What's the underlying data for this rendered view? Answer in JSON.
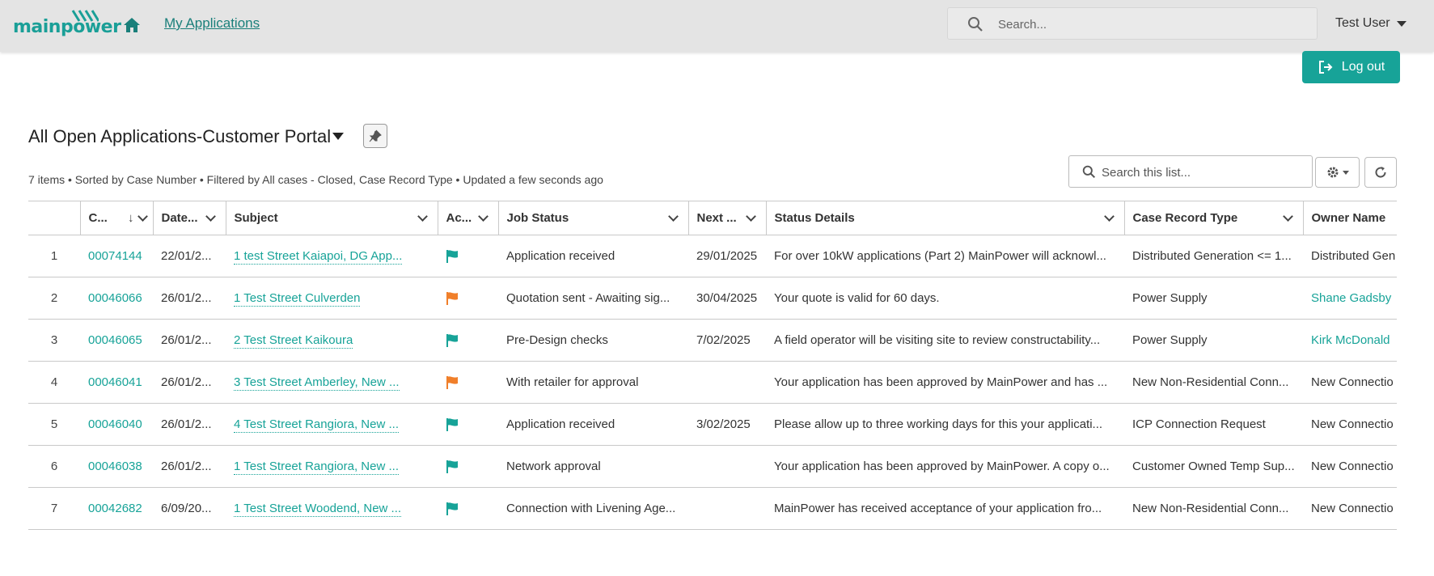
{
  "header": {
    "logo_text": "mainpower",
    "nav_link": "My Applications",
    "search_placeholder": "Search...",
    "user_name": "Test User",
    "logout_label": "Log out"
  },
  "list": {
    "title": "All Open Applications-Customer Portal",
    "meta": "7 items • Sorted by Case Number • Filtered by All cases - Closed, Case Record Type • Updated a few seconds ago",
    "search_placeholder": "Search this list...",
    "columns": [
      "C...",
      "Date...",
      "Subject",
      "Ac...",
      "Job Status",
      "Next ...",
      "Status Details",
      "Case Record Type",
      "Owner Name"
    ],
    "rows": [
      {
        "num": "1",
        "case": "00074144",
        "date": "22/01/2...",
        "subject": "1 test Street Kaiapoi, DG App...",
        "flag": "teal",
        "job_status": "Application received",
        "next": "29/01/2025",
        "status_details": "For over 10kW applications (Part 2) MainPower will acknowl...",
        "record_type": "Distributed Generation <= 1...",
        "owner": "Distributed Gen",
        "owner_link": false
      },
      {
        "num": "2",
        "case": "00046066",
        "date": "26/01/2...",
        "subject": "1 Test Street Culverden",
        "flag": "orange",
        "job_status": "Quotation sent - Awaiting sig...",
        "next": "30/04/2025",
        "status_details": "Your quote is valid for 60 days.",
        "record_type": "Power Supply",
        "owner": "Shane Gadsby",
        "owner_link": true
      },
      {
        "num": "3",
        "case": "00046065",
        "date": "26/01/2...",
        "subject": "2 Test Street Kaikoura",
        "flag": "teal",
        "job_status": "Pre-Design checks",
        "next": "7/02/2025",
        "status_details": "A field operator will be visiting site to review constructability...",
        "record_type": "Power Supply",
        "owner": "Kirk McDonald",
        "owner_link": true
      },
      {
        "num": "4",
        "case": "00046041",
        "date": "26/01/2...",
        "subject": "3 Test Street Amberley, New ...",
        "flag": "orange",
        "job_status": "With retailer for approval",
        "next": "",
        "status_details": "Your application has been approved by MainPower and has ...",
        "record_type": "New Non-Residential Conn...",
        "owner": "New Connectio",
        "owner_link": false
      },
      {
        "num": "5",
        "case": "00046040",
        "date": "26/01/2...",
        "subject": "4 Test Street Rangiora, New ...",
        "flag": "teal",
        "job_status": "Application received",
        "next": "3/02/2025",
        "status_details": "Please allow up to three working days for this your applicati...",
        "record_type": "ICP Connection Request",
        "owner": "New Connectio",
        "owner_link": false
      },
      {
        "num": "6",
        "case": "00046038",
        "date": "26/01/2...",
        "subject": "1 Test Street Rangiora, New ...",
        "flag": "teal",
        "job_status": "Network approval",
        "next": "",
        "status_details": "Your application has been approved by MainPower. A copy o...",
        "record_type": "Customer Owned Temp Sup...",
        "owner": "New Connectio",
        "owner_link": false
      },
      {
        "num": "7",
        "case": "00042682",
        "date": "6/09/20...",
        "subject": "1 Test Street Woodend, New ...",
        "flag": "teal",
        "job_status": "Connection with Livening Age...",
        "next": "",
        "status_details": "MainPower has received acceptance of your application fro...",
        "record_type": "New Non-Residential Conn...",
        "owner": "New Connectio",
        "owner_link": false
      }
    ]
  },
  "colors": {
    "brand_teal": "#17a398",
    "flag_teal": "#17a398",
    "flag_orange": "#f07f2a",
    "topbar_bg": "#e4e4e4"
  }
}
